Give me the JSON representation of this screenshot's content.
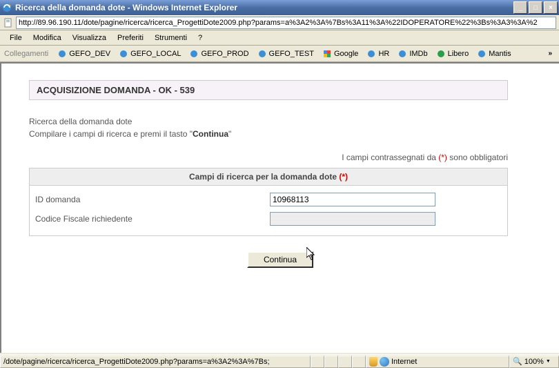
{
  "window": {
    "title": "Ricerca della domanda dote - Windows Internet Explorer"
  },
  "address": {
    "url": "http://89.96.190.11/dote/pagine/ricerca/ricerca_ProgettiDote2009.php?params=a%3A2%3A%7Bs%3A11%3A%22IDOPERATORE%22%3Bs%3A3%3A%2"
  },
  "menu": {
    "file": "File",
    "modifica": "Modifica",
    "visualizza": "Visualizza",
    "preferiti": "Preferiti",
    "strumenti": "Strumenti",
    "help": "?"
  },
  "links": {
    "label": "Collegamenti",
    "items": [
      "GEFO_DEV",
      "GEFO_LOCAL",
      "GEFO_PROD",
      "GEFO_TEST",
      "Google",
      "HR",
      "IMDb",
      "Libero",
      "Mantis"
    ]
  },
  "page": {
    "status_header": "ACQUISIZIONE DOMANDA - OK - 539",
    "help_line1": "Ricerca della domanda dote",
    "help_line2_a": "Compilare i campi di ricerca e premi il tasto \"",
    "help_line2_b": "Continua",
    "help_line2_c": "\"",
    "required_note_a": "I campi contrassegnati da ",
    "required_note_b": "(*)",
    "required_note_c": " sono obbligatori",
    "form_header_a": "Campi di ricerca per la domanda dote ",
    "form_header_b": "(*)",
    "label_id": "ID domanda",
    "value_id": "10968113",
    "label_cf": "Codice Fiscale richiedente",
    "value_cf": "",
    "button_continua": "Continua"
  },
  "status": {
    "path": "/dote/pagine/ricerca/ricerca_ProgettiDote2009.php?params=a%3A2%3A%7Bs;",
    "zone": "Internet",
    "zoom": "100%"
  }
}
